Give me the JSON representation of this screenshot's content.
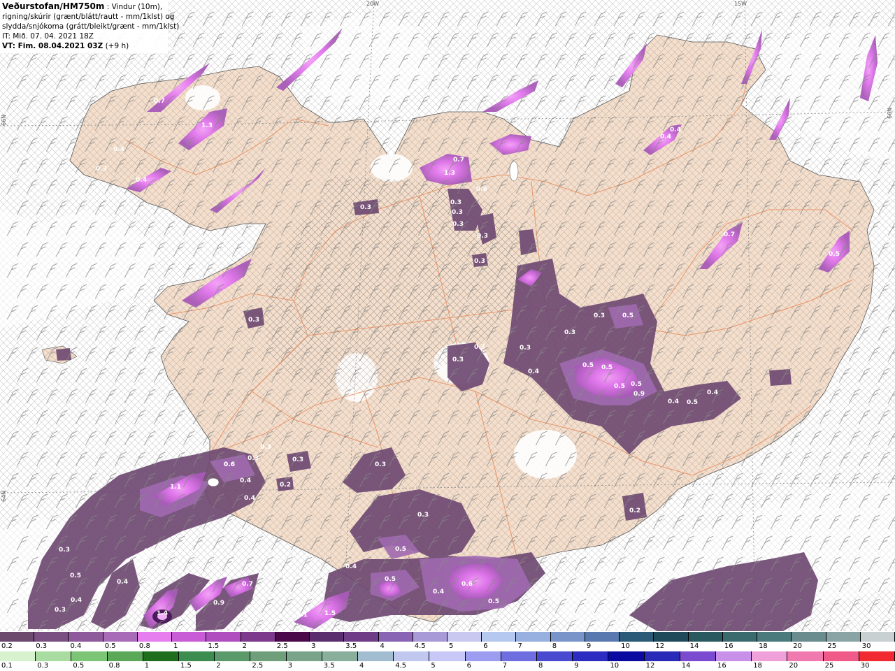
{
  "header": {
    "title": "Veðurstofan/HM750m",
    "desc1": ": Vindur (10m),",
    "desc2": "rigning/skúrir (grænt/blátt/rautt - mm/1klst) og",
    "desc3": "slydda/snjókoma (grátt/bleikt/grænt - mm/1klst)",
    "it": "IT: Mið. 07. 04. 2021 18Z",
    "vt_label": "VT: Fim. 08.04.2021 03Z",
    "vt_offset": "(+9 h)"
  },
  "grid_labels": {
    "lon20": "20W",
    "lon15": "15W",
    "lat66_left": "66N",
    "lat66_right": "66N",
    "lat64_left": "64N"
  },
  "map_values": [
    {
      "t": "0.4"
    },
    {
      "t": "0.3"
    },
    {
      "t": "0.4"
    },
    {
      "t": "0.7"
    },
    {
      "t": "1.3"
    },
    {
      "t": "0.6"
    },
    {
      "t": "0.3"
    },
    {
      "t": "0.3"
    },
    {
      "t": "0.3"
    },
    {
      "t": "0.7"
    },
    {
      "t": "1.3"
    },
    {
      "t": "0.6"
    },
    {
      "t": "0.3"
    },
    {
      "t": "0.3"
    },
    {
      "t": "0.3"
    },
    {
      "t": "0.3"
    },
    {
      "t": "0.4"
    },
    {
      "t": "0.4"
    },
    {
      "t": "0.7"
    },
    {
      "t": "0.5"
    },
    {
      "t": "0.3"
    },
    {
      "t": "0.5"
    },
    {
      "t": "0.3"
    },
    {
      "t": "0.3"
    },
    {
      "t": "0.4"
    },
    {
      "t": "0.5"
    },
    {
      "t": "0.5"
    },
    {
      "t": "0.5"
    },
    {
      "t": "0.5"
    },
    {
      "t": "0.9"
    },
    {
      "t": "0.4"
    },
    {
      "t": "0.5"
    },
    {
      "t": "0.4"
    },
    {
      "t": "0.3"
    },
    {
      "t": "0.3"
    },
    {
      "t": "0.3"
    },
    {
      "t": "0.3"
    },
    {
      "t": "0.6"
    },
    {
      "t": "0.4"
    },
    {
      "t": "1.1"
    },
    {
      "t": "0.4"
    },
    {
      "t": "0.2"
    },
    {
      "t": "0.3"
    },
    {
      "t": "0.3"
    },
    {
      "t": "0.3"
    },
    {
      "t": "0.5"
    },
    {
      "t": "0.4"
    },
    {
      "t": "0.8"
    },
    {
      "t": "0.4"
    },
    {
      "t": "0.5"
    },
    {
      "t": "0.6"
    },
    {
      "t": "0.3"
    },
    {
      "t": "0.5"
    },
    {
      "t": "0.4"
    },
    {
      "t": "1.1"
    },
    {
      "t": "1.5"
    },
    {
      "t": "0.9"
    },
    {
      "t": "0.7"
    },
    {
      "t": "0.4"
    },
    {
      "t": "1.4"
    },
    {
      "t": "0.3"
    },
    {
      "t": "0.2"
    },
    {
      "t": "0.5"
    }
  ],
  "legend_snow": {
    "labels": [
      "0.2",
      "0.3",
      "0.4",
      "0.5",
      "0.8",
      "1",
      "1.5",
      "2",
      "2.5",
      "3",
      "3.5",
      "4",
      "4.5",
      "5",
      "6",
      "7",
      "8",
      "9",
      "10",
      "12",
      "14",
      "16",
      "18",
      "20",
      "25",
      "30"
    ],
    "colors": [
      "#6b4a6e",
      "#7a4f82",
      "#8f5a9c",
      "#a86bb8",
      "#e67ef0",
      "#c85cd6",
      "#b04ec0",
      "#7d3a8c",
      "#4a0a4a",
      "#5a2d6e",
      "#6f3c88",
      "#8a64b4",
      "#a89ad6",
      "#c8c8f0",
      "#b4c8f0",
      "#98b0e0",
      "#7894c8",
      "#5a78b0",
      "#2a5a78",
      "#1f4a5a",
      "#2a5a60",
      "#3a6a6e",
      "#4a7a7c",
      "#6a8c8e",
      "#8aa4a6",
      "#c8d0d2"
    ]
  },
  "legend_rain": {
    "labels": [
      "0.1",
      "0.3",
      "0.5",
      "0.8",
      "1",
      "1.5",
      "2",
      "2.5",
      "3",
      "3.5",
      "4",
      "4.5",
      "5",
      "6",
      "7",
      "8",
      "9",
      "10",
      "12",
      "14",
      "16",
      "18",
      "20",
      "25",
      "30"
    ],
    "colors": [
      "#d8f2d0",
      "#a8dca0",
      "#7cc476",
      "#5aa858",
      "#1e6e1e",
      "#3c8c50",
      "#5a9a6a",
      "#6e9e7a",
      "#7aa48a",
      "#8aae9c",
      "#a2bcd0",
      "#c0c8f0",
      "#c8c8f8",
      "#9c9cf0",
      "#6e6ee0",
      "#4a4ad0",
      "#2c2cc0",
      "#0a0aa0",
      "#2a2ab8",
      "#7a4ad0",
      "#c890e8",
      "#f0a0d8",
      "#f07ab0",
      "#f05a88",
      "#f02a30"
    ]
  }
}
